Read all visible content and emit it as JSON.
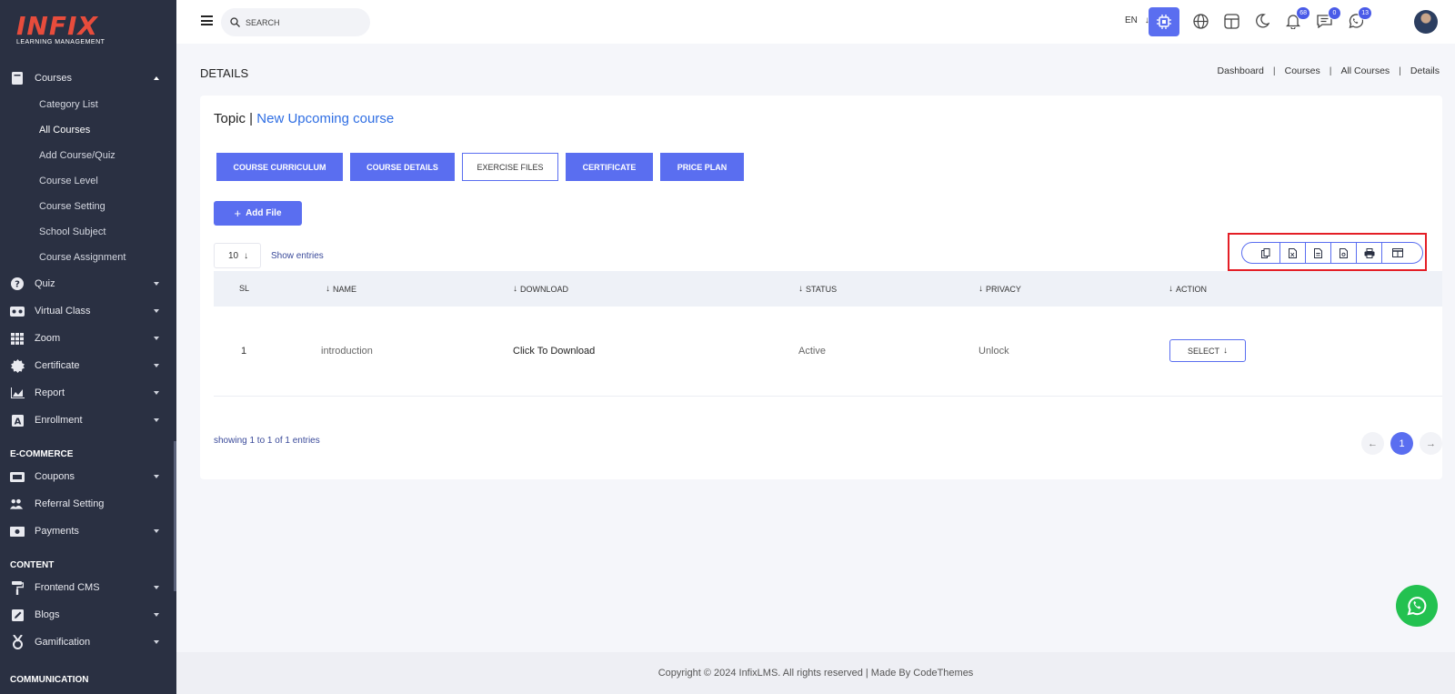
{
  "brand": {
    "logo": "INFIX",
    "tagline": "LEARNING MANAGEMENT"
  },
  "sidebar": {
    "courses": {
      "label": "Courses",
      "items": [
        "Category List",
        "All Courses",
        "Add Course/Quiz",
        "Course Level",
        "Course Setting",
        "School Subject",
        "Course Assignment"
      ]
    },
    "menu": [
      "Quiz",
      "Virtual Class",
      "Zoom",
      "Certificate",
      "Report",
      "Enrollment"
    ],
    "ecommerce_label": "E-COMMERCE",
    "ecommerce": [
      "Coupons",
      "Referral Setting",
      "Payments"
    ],
    "content_label": "CONTENT",
    "content": [
      "Frontend CMS",
      "Blogs",
      "Gamification"
    ],
    "communication_label": "COMMUNICATION"
  },
  "header": {
    "search_placeholder": "SEARCH",
    "lang": "EN",
    "notifications_count": "68",
    "messages_count": "0",
    "chat_count": "13"
  },
  "page": {
    "title": "DETAILS",
    "breadcrumb": [
      "Dashboard",
      "Courses",
      "All Courses",
      "Details"
    ]
  },
  "card": {
    "topic_label": "Topic |",
    "course_name": "New Upcoming course",
    "tabs": [
      "COURSE CURRICULUM",
      "COURSE DETAILS",
      "EXERCISE FILES",
      "CERTIFICATE",
      "PRICE PLAN"
    ],
    "add_file": "Add File",
    "entries_value": "10",
    "entries_label": "Show entries",
    "columns": [
      "SL",
      "NAME",
      "DOWNLOAD",
      "STATUS",
      "PRIVACY",
      "ACTION"
    ],
    "rows": [
      {
        "sl": "1",
        "name": "introduction",
        "download": "Click To Download",
        "status": "Active",
        "privacy": "Unlock",
        "action": "SELECT"
      }
    ],
    "showing": "showing 1 to 1 of 1 entries",
    "current_page": "1"
  },
  "footer": {
    "text": "Copyright © 2024 InfixLMS. All rights reserved | Made By CodeThemes"
  },
  "colors": {
    "accent": "#5a6ef0",
    "sidebar": "#2a3042",
    "highlight": "#e41e26",
    "whatsapp": "#23c150"
  }
}
